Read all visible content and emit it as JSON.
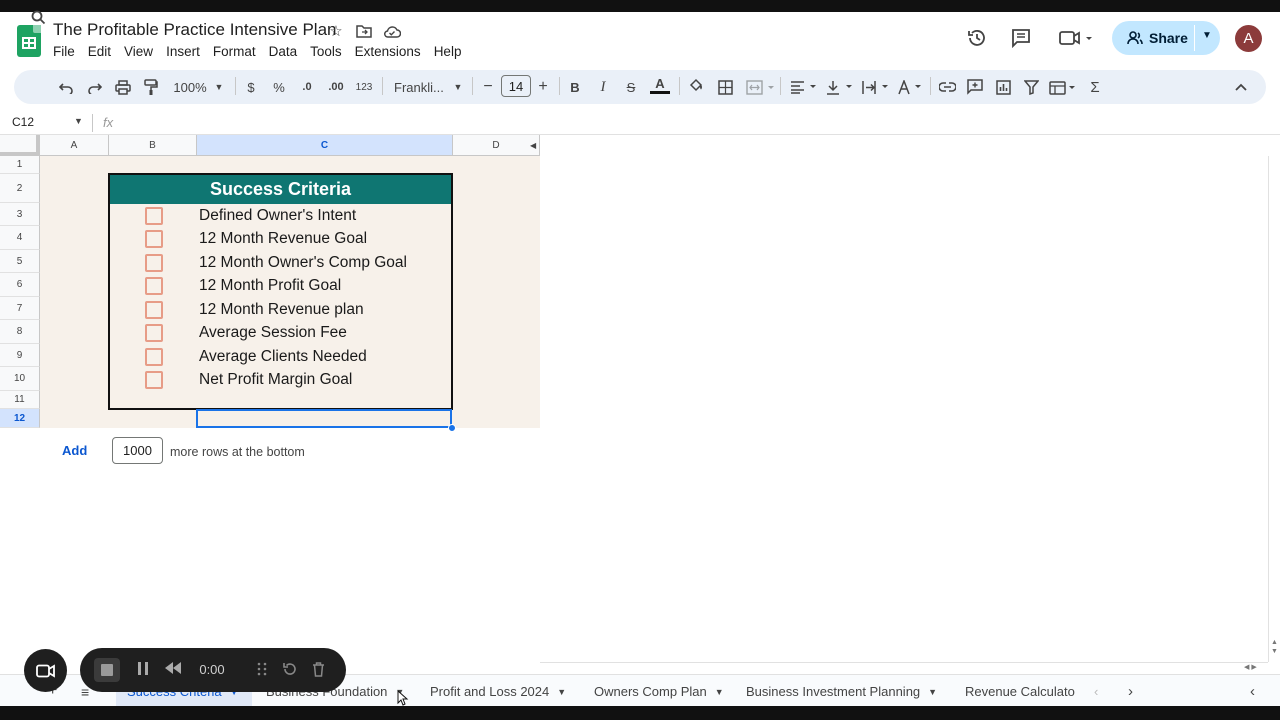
{
  "document": {
    "title": "The Profitable Practice Intensive Plan"
  },
  "menu": [
    "File",
    "Edit",
    "View",
    "Insert",
    "Format",
    "Data",
    "Tools",
    "Extensions",
    "Help"
  ],
  "header_right": {
    "share_label": "Share",
    "avatar_initial": "A"
  },
  "toolbar": {
    "zoom": "100%",
    "currency": "$",
    "percent": "%",
    "decrease_decimal": ".0",
    "increase_decimal": ".00",
    "number_format": "123",
    "font": "Frankli...",
    "font_size": "14",
    "bold": "B",
    "italic": "I",
    "strike": "S",
    "text_color": "A"
  },
  "formula_bar": {
    "name_box": "C12",
    "fx": "fx",
    "value": ""
  },
  "columns": [
    "A",
    "B",
    "C",
    "D"
  ],
  "rows": [
    "1",
    "2",
    "3",
    "4",
    "5",
    "6",
    "7",
    "8",
    "9",
    "10",
    "11",
    "12"
  ],
  "selected": {
    "column": "C",
    "row": "12"
  },
  "success_criteria": {
    "title": "Success Criteria",
    "items": [
      {
        "label": "Defined Owner's Intent",
        "checked": false
      },
      {
        "label": "12 Month Revenue Goal",
        "checked": false
      },
      {
        "label": "12 Month Owner's Comp Goal",
        "checked": false
      },
      {
        "label": "12 Month Profit Goal",
        "checked": false
      },
      {
        "label": "12 Month Revenue plan",
        "checked": false
      },
      {
        "label": "Average Session Fee",
        "checked": false
      },
      {
        "label": "Average Clients Needed",
        "checked": false
      },
      {
        "label": "Net Profit Margin Goal",
        "checked": false
      }
    ]
  },
  "add_rows": {
    "button": "Add",
    "count": "1000",
    "suffix": "more rows at the bottom"
  },
  "sheet_tabs": [
    {
      "label": "Success Criteria",
      "active": true
    },
    {
      "label": "Business Foundation",
      "active": false
    },
    {
      "label": "Profit and Loss 2024",
      "active": false
    },
    {
      "label": "Owners Comp Plan",
      "active": false
    },
    {
      "label": "Business Investment Planning",
      "active": false
    },
    {
      "label": "Revenue Calculato",
      "active": false
    }
  ],
  "recorder": {
    "time": "0:00"
  },
  "colors": {
    "header_teal": "#0f7672",
    "checkbox_border": "#e79c87",
    "sheet_background": "#f7f1ea",
    "selection_blue": "#1a73e8",
    "share_bg": "#c2e7ff"
  }
}
